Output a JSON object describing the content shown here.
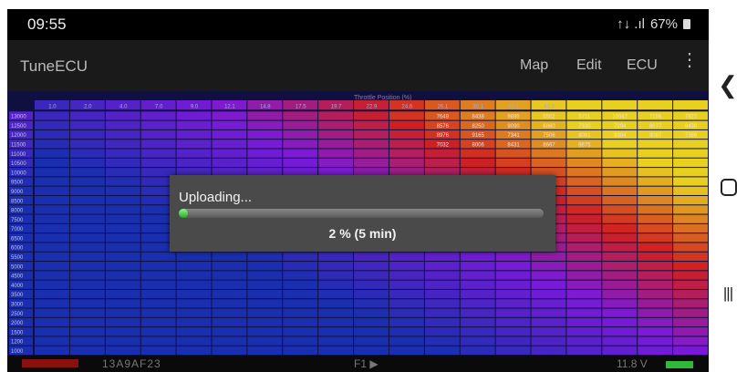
{
  "status_bar": {
    "time": "09:55",
    "signal": "↑↓ .ıl",
    "battery_text": "67%"
  },
  "app_bar": {
    "title": "TuneECU",
    "menu": [
      "Map",
      "Edit",
      "ECU"
    ],
    "overflow_icon": "more-vert-icon"
  },
  "table": {
    "axis_title": "Throttle Position (%)",
    "colors": {
      "low": "#1a2fb0",
      "mid": "#7a1ad8",
      "high": "#d02020",
      "peak": "#e8d020",
      "dialog_bg": "#4a4a4a",
      "progress": "#3dbb3d"
    },
    "column_headers": [
      "1.0",
      "2.0",
      "4.0",
      "7.0",
      "9.0",
      "12.1",
      "14.8",
      "17.5",
      "19.7",
      "22.9",
      "24.6",
      "26.1",
      "30.1",
      "36.1",
      "41.0",
      "",
      "",
      "",
      ""
    ],
    "row_headers": [
      "13000",
      "12500",
      "12000",
      "11500",
      "11000",
      "10500",
      "10000",
      "9500",
      "9000",
      "8500",
      "8000",
      "7500",
      "7000",
      "6500",
      "6000",
      "5500",
      "5000",
      "4500",
      "4000",
      "3500",
      "3000",
      "2500",
      "2000",
      "1500",
      "1200",
      "1000",
      "800"
    ],
    "visible_values": [
      "7649",
      "8438",
      "9895",
      "5502",
      "5711",
      "10047",
      "7156",
      "7827",
      "8576",
      "8250",
      "9090",
      "6860",
      "7330",
      "7294",
      "8077",
      "8430",
      "8976",
      "9165",
      "7341",
      "7506",
      "8081",
      "8304",
      "9087",
      "7386",
      "7032",
      "8006",
      "8431",
      "8667",
      "8875"
    ]
  },
  "dialog": {
    "label": "Uploading...",
    "progress_text": "2 % (5 min)",
    "progress_fraction": 0.02
  },
  "footer": {
    "ecu_id": "13A9AF23",
    "page": "F1 ▶",
    "voltage": "11.8 V"
  },
  "nav": {
    "back_icon": "back-chevron-icon",
    "home_icon": "home-icon",
    "recents_icon": "recents-icon"
  }
}
